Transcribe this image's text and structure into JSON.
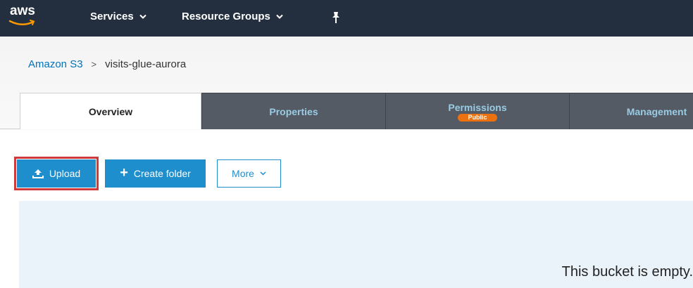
{
  "topnav": {
    "logo_text": "aws",
    "services_label": "Services",
    "resource_groups_label": "Resource Groups",
    "bg_color": "#232f3e",
    "icons": {
      "dropdown": "chevron-down-icon",
      "pin": "pin-icon"
    }
  },
  "breadcrumb": {
    "root": "Amazon S3",
    "separator": ">",
    "current": "visits-glue-aurora"
  },
  "tabs": [
    {
      "label": "Overview",
      "active": true
    },
    {
      "label": "Properties",
      "active": false
    },
    {
      "label": "Permissions",
      "badge": "Public",
      "active": false
    },
    {
      "label": "Management",
      "active": false
    }
  ],
  "actions": {
    "upload_label": "Upload",
    "create_folder_label": "Create folder",
    "more_label": "More",
    "highlight_color": "#d13a3a",
    "button_color": "#1f8ecd"
  },
  "empty_state": {
    "message": "This bucket is empty."
  }
}
